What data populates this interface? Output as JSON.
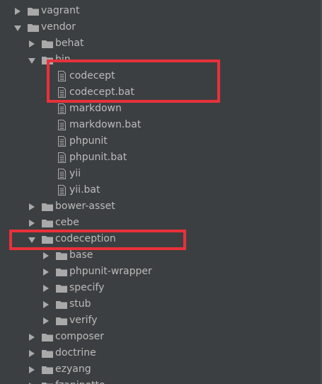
{
  "tree": {
    "items": [
      {
        "label": "vagrant",
        "type": "folder",
        "state": "collapsed",
        "level": 0
      },
      {
        "label": "vendor",
        "type": "folder",
        "state": "expanded",
        "level": 0
      },
      {
        "label": "behat",
        "type": "folder",
        "state": "collapsed",
        "level": 1
      },
      {
        "label": "bin",
        "type": "folder",
        "state": "expanded",
        "level": 1
      },
      {
        "label": "codecept",
        "type": "file",
        "level": 2
      },
      {
        "label": "codecept.bat",
        "type": "file",
        "level": 2
      },
      {
        "label": "markdown",
        "type": "file",
        "level": 2
      },
      {
        "label": "markdown.bat",
        "type": "file",
        "level": 2
      },
      {
        "label": "phpunit",
        "type": "file",
        "level": 2
      },
      {
        "label": "phpunit.bat",
        "type": "file",
        "level": 2
      },
      {
        "label": "yii",
        "type": "file",
        "level": 2
      },
      {
        "label": "yii.bat",
        "type": "file",
        "level": 2
      },
      {
        "label": "bower-asset",
        "type": "folder",
        "state": "collapsed",
        "level": 1
      },
      {
        "label": "cebe",
        "type": "folder",
        "state": "collapsed",
        "level": 1
      },
      {
        "label": "codeception",
        "type": "folder",
        "state": "expanded",
        "level": 1
      },
      {
        "label": "base",
        "type": "folder",
        "state": "collapsed",
        "level": 2
      },
      {
        "label": "phpunit-wrapper",
        "type": "folder",
        "state": "collapsed",
        "level": 2
      },
      {
        "label": "specify",
        "type": "folder",
        "state": "collapsed",
        "level": 2
      },
      {
        "label": "stub",
        "type": "folder",
        "state": "collapsed",
        "level": 2
      },
      {
        "label": "verify",
        "type": "folder",
        "state": "collapsed",
        "level": 2
      },
      {
        "label": "composer",
        "type": "folder",
        "state": "collapsed",
        "level": 1
      },
      {
        "label": "doctrine",
        "type": "folder",
        "state": "collapsed",
        "level": 1
      },
      {
        "label": "ezyang",
        "type": "folder",
        "state": "collapsed",
        "level": 1
      },
      {
        "label": "fzaninotto",
        "type": "folder",
        "state": "collapsed",
        "level": 1
      }
    ]
  },
  "colors": {
    "background": "#3c3f41",
    "text": "#bbbbbb",
    "icon": "#a9a9a9",
    "annotation": "#e8313a"
  }
}
